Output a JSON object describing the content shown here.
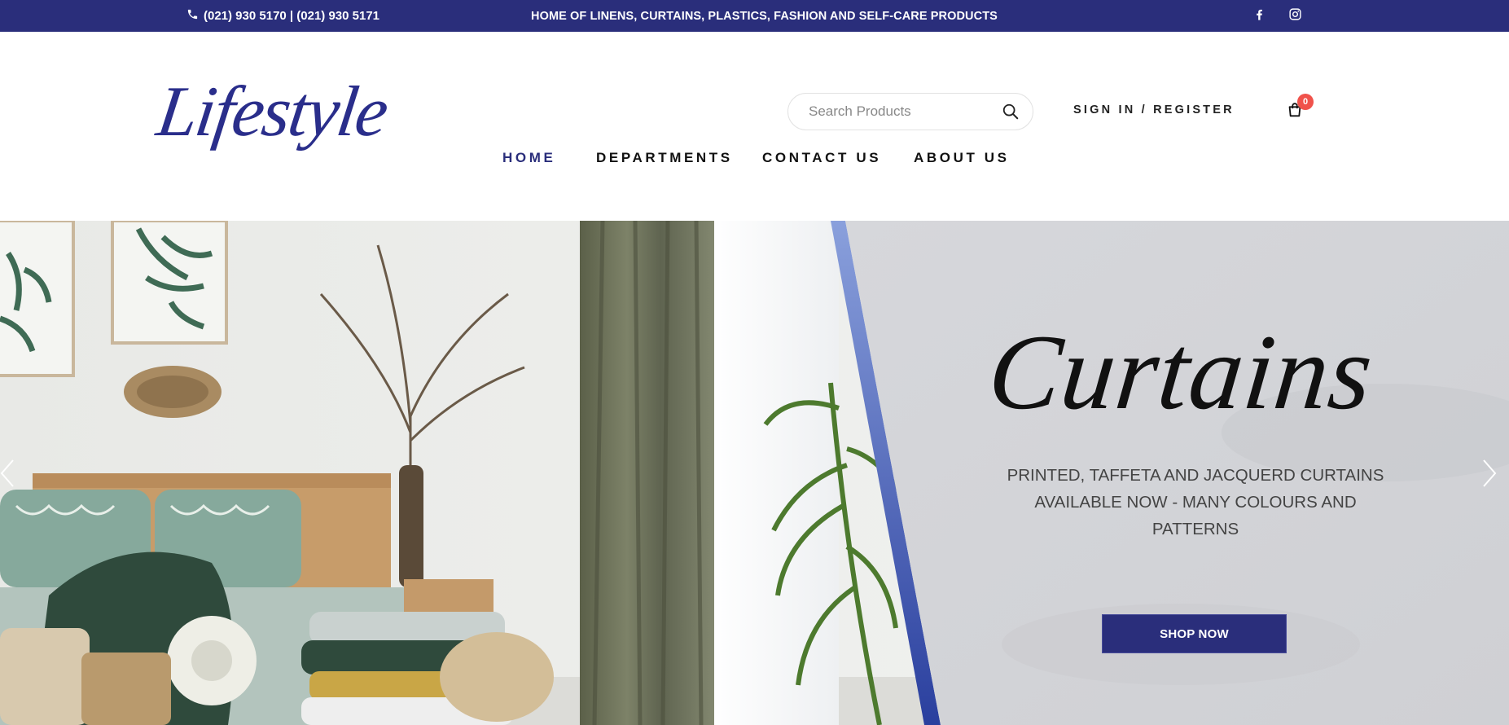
{
  "topbar": {
    "phone": "(021) 930 5170 | (021) 930 5171",
    "tagline": "HOME OF LINENS, CURTAINS, PLASTICS, FASHION AND SELF-CARE PRODUCTS",
    "icons": [
      "phone-icon",
      "facebook-icon",
      "instagram-icon"
    ],
    "background": "#2a2e7b"
  },
  "header": {
    "logo_text": "Lifestyle",
    "search": {
      "placeholder": "Search Products",
      "value": ""
    },
    "signin_label": "SIGN IN / REGISTER",
    "cart": {
      "count": "0",
      "icon": "shopping-bag-icon"
    },
    "nav": [
      {
        "label": "HOME",
        "active": true
      },
      {
        "label": "DEPARTMENTS",
        "active": false
      },
      {
        "label": "CONTACT US",
        "active": false
      },
      {
        "label": "ABOUT US",
        "active": false
      }
    ]
  },
  "hero": {
    "title": "Curtains",
    "subtitle_lines": [
      "PRINTED, TAFFETA AND JACQUERD CURTAINS",
      "AVAILABLE NOW - MANY COLOURS AND",
      "PATTERNS"
    ],
    "button_label": "SHOP NOW",
    "icons": [
      "chevron-left-icon",
      "chevron-right-icon"
    ]
  },
  "colors": {
    "brand": "#2a2e7b",
    "badge": "#f0524b",
    "hero_panel": "#d3d4d8"
  }
}
